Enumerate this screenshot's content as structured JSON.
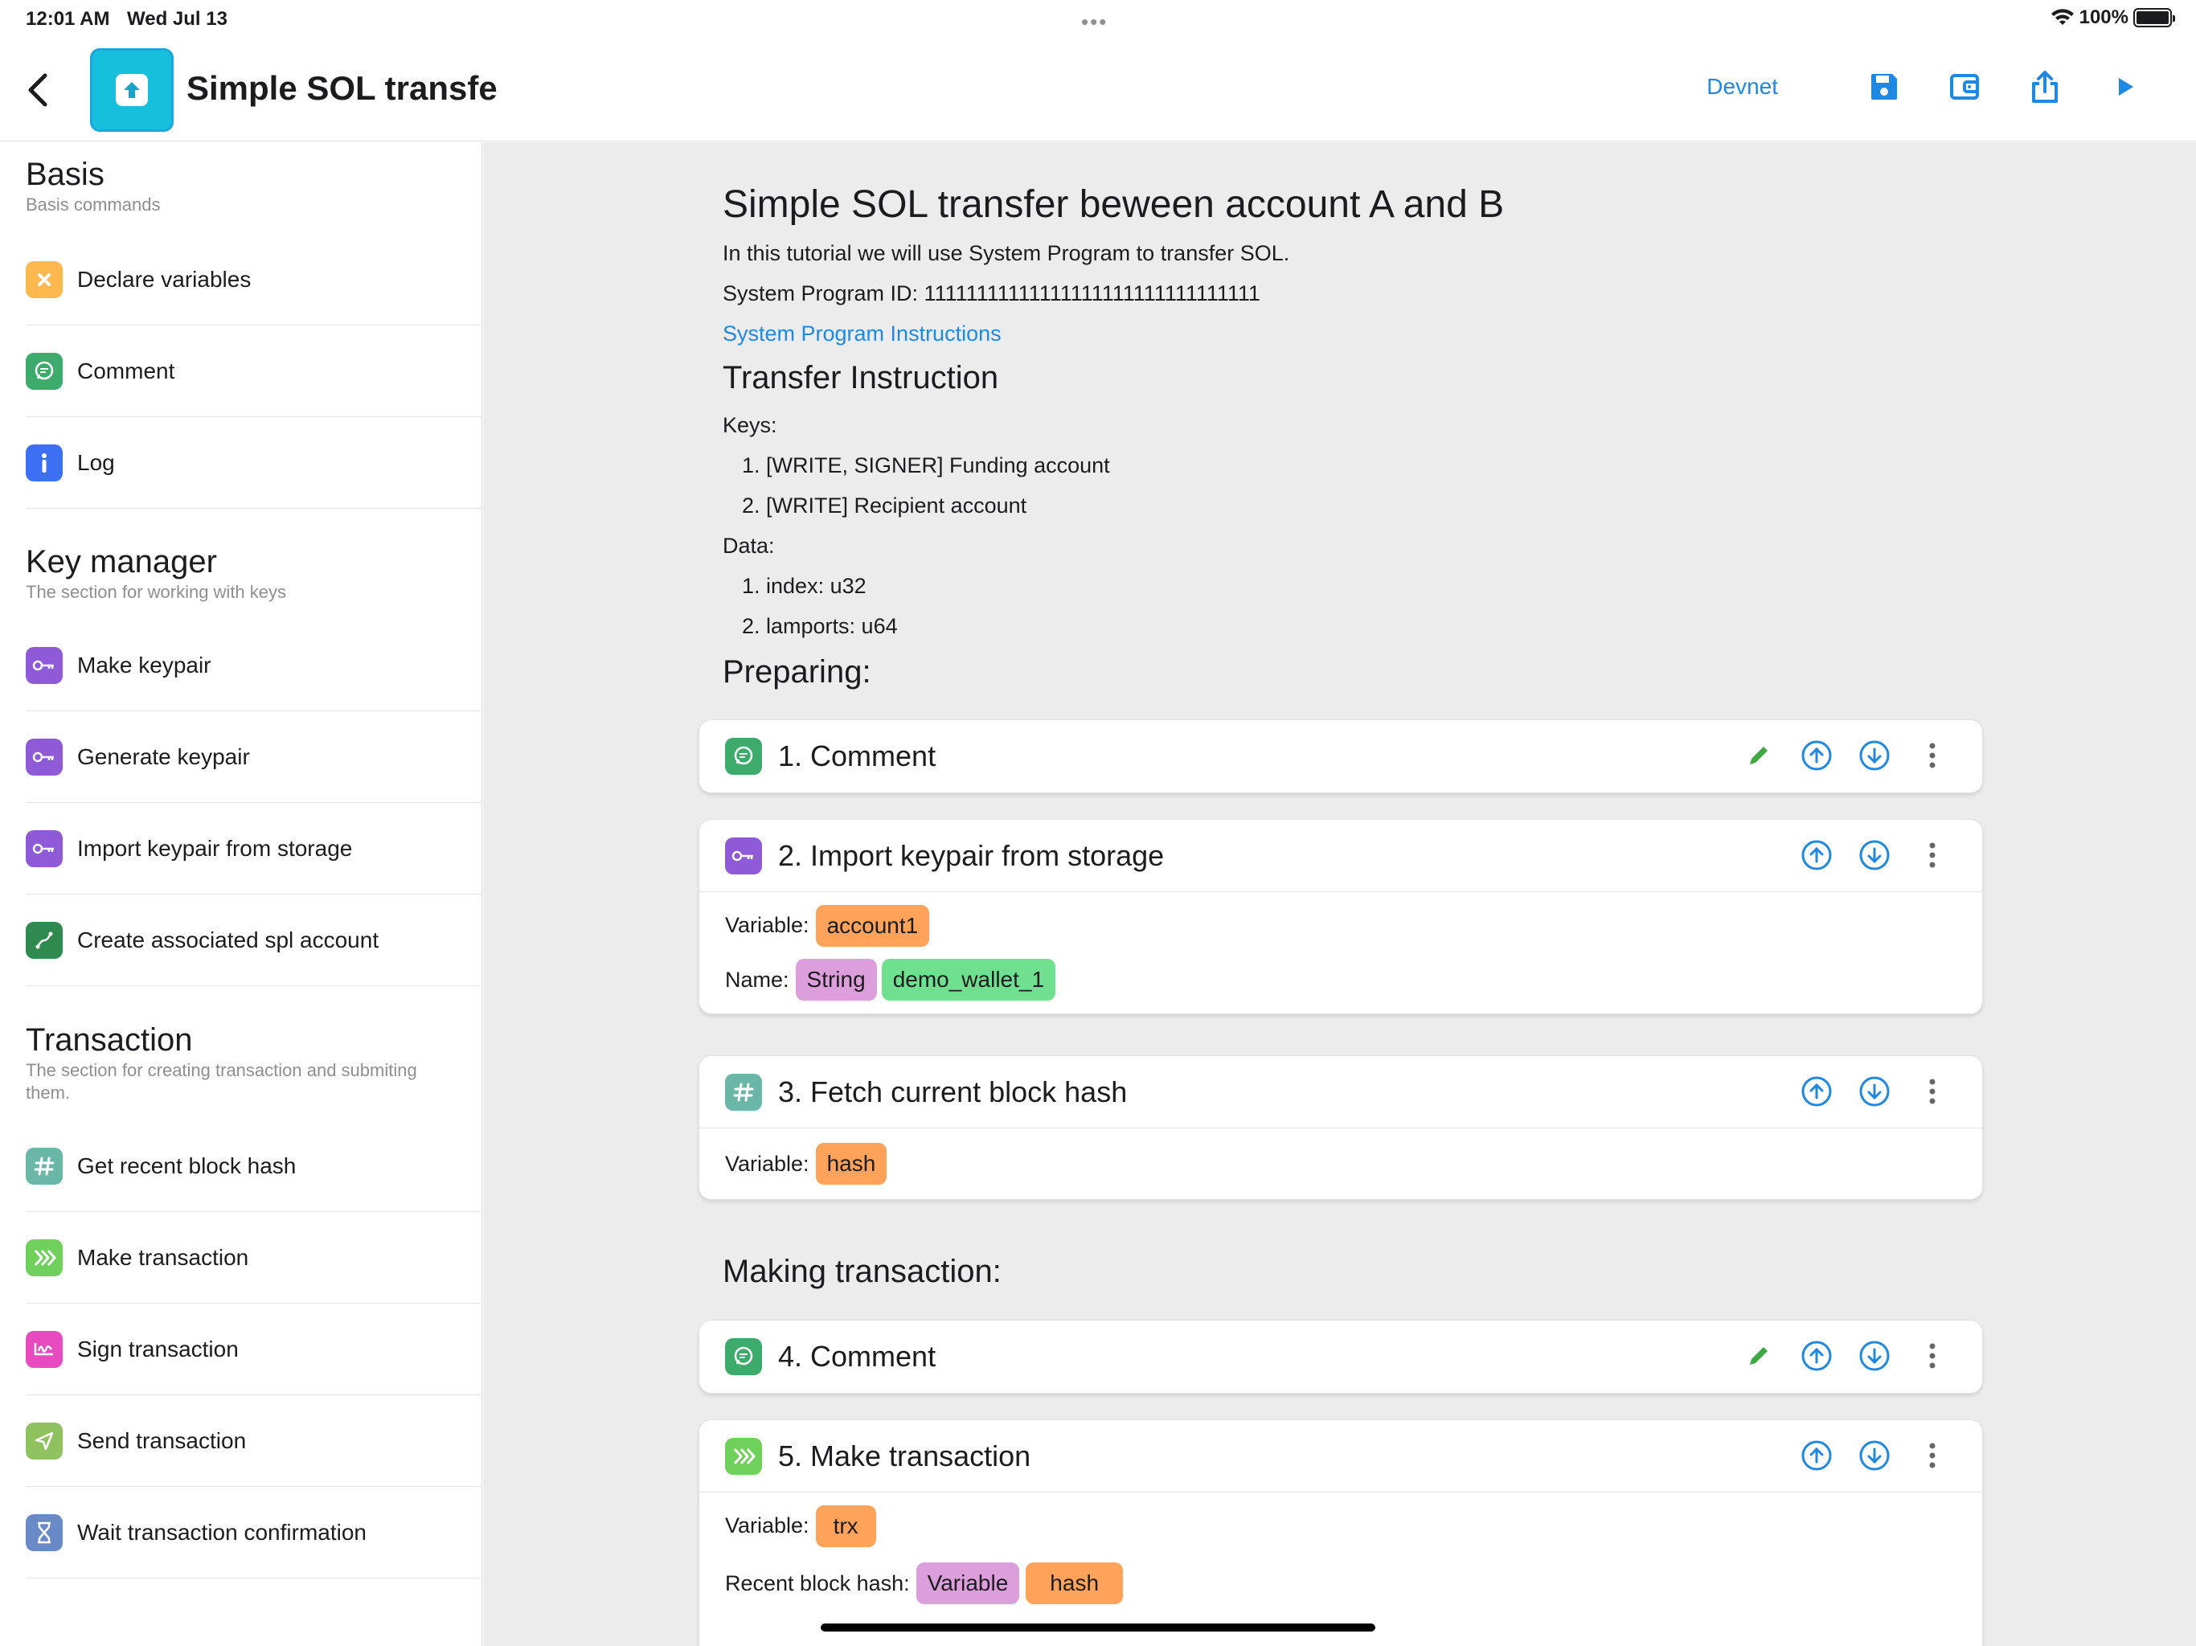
{
  "status": {
    "time": "12:01 AM",
    "date": "Wed Jul 13",
    "battery": "100%"
  },
  "nav": {
    "title": "Simple SOL transfe",
    "network": "Devnet"
  },
  "sidebar": {
    "sections": [
      {
        "title": "Basis",
        "subtitle": "Basis commands",
        "items": [
          {
            "label": "Declare variables"
          },
          {
            "label": "Comment"
          },
          {
            "label": "Log"
          }
        ]
      },
      {
        "title": "Key manager",
        "subtitle": "The section for working with keys",
        "items": [
          {
            "label": "Make keypair"
          },
          {
            "label": "Generate keypair"
          },
          {
            "label": "Import keypair from storage"
          },
          {
            "label": "Create associated spl account"
          }
        ]
      },
      {
        "title": "Transaction",
        "subtitle": "The section for creating transaction and submiting them.",
        "items": [
          {
            "label": "Get recent block hash"
          },
          {
            "label": "Make transaction"
          },
          {
            "label": "Sign transaction"
          },
          {
            "label": "Send transaction"
          },
          {
            "label": "Wait transaction confirmation"
          }
        ]
      }
    ]
  },
  "doc": {
    "title": "Simple SOL transfer beween account A and B",
    "intro": "In this tutorial we will use System Program to transfer SOL.",
    "program_id": "System Program ID: 11111111111111111111111111111111",
    "link": "System Program Instructions",
    "h_transfer": "Transfer Instruction",
    "keys_label": "Keys:",
    "keys": [
      "1. [WRITE, SIGNER] Funding account",
      "2. [WRITE] Recipient account"
    ],
    "data_label": "Data:",
    "data_items": [
      "1. index: u32",
      "2. lamports: u64"
    ],
    "h_preparing": "Preparing:",
    "h_making": "Making transaction:"
  },
  "cards": [
    {
      "title": "1. Comment"
    },
    {
      "title": "2. Import keypair from storage",
      "variable_label": "Variable:",
      "variable": "account1",
      "name_label": "Name:",
      "name_type": "String",
      "name_value": "demo_wallet_1"
    },
    {
      "title": "3. Fetch current block hash",
      "variable_label": "Variable:",
      "variable": "hash"
    },
    {
      "title": "4. Comment"
    },
    {
      "title": "5. Make transaction",
      "variable_label": "Variable:",
      "variable": "trx",
      "hash_label": "Recent block hash:",
      "hash_type": "Variable",
      "hash_value": "hash"
    }
  ]
}
